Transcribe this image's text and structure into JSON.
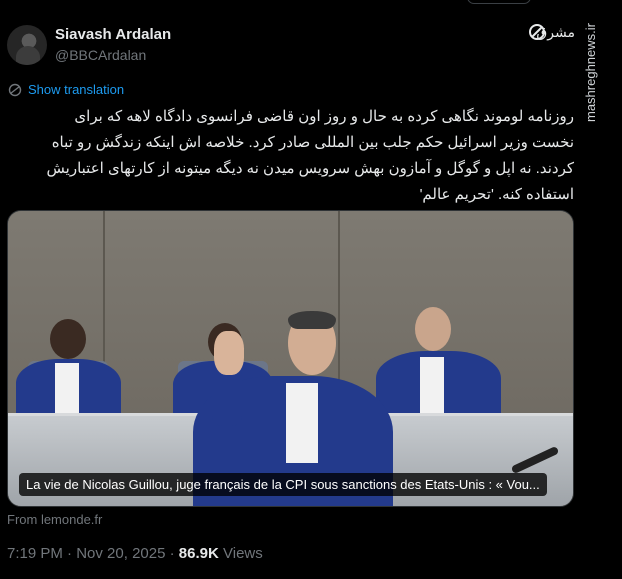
{
  "author": {
    "display_name": "Siavash Ardalan",
    "handle": "@BBCArdalan"
  },
  "translate": {
    "label": "Show translation"
  },
  "tweet": {
    "lines": [
      "روزنامه لوموند نگاهی کرده به حال و روز اون قاضی فرانسوی دادگاه لاهه که برای",
      "نخست وزیر اسرائیل حکم جلب بین المللی صادر کرد. خلاصه اش اینکه زندگش رو تباه",
      "کردند. نه اپل و گوگل و آمازون بهش سرویس میدن نه دیگه میتونه از کارتهای اعتباریش",
      "استفاده کنه. 'تحریم عالم'"
    ]
  },
  "media": {
    "caption": "La vie de Nicolas Guillou, juge français de la CPI sous sanctions des Etats-Unis : « Vou..."
  },
  "source": {
    "label": "From lemonde.fr"
  },
  "meta": {
    "time": "7:19 PM",
    "separator": "·",
    "date": "Nov 20, 2025",
    "views_count": "86.9K",
    "views_label": "Views"
  },
  "watermark": {
    "side_text": "mashreghnews.ir",
    "logo_text": "مشرق"
  },
  "icons": {
    "translate": "globe-icon",
    "more": "more-options-icon"
  }
}
